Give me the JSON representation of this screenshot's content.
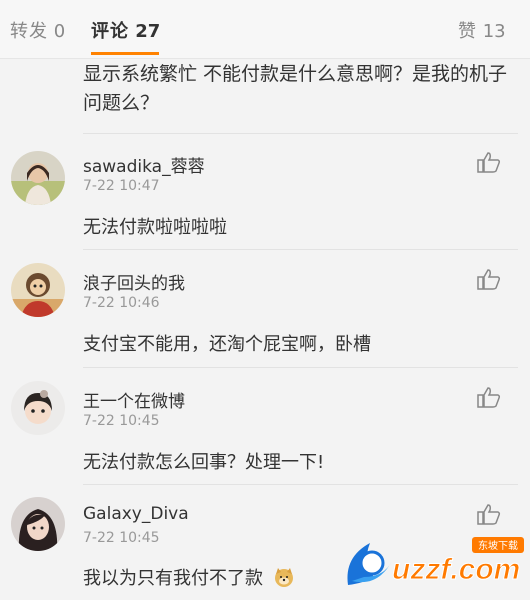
{
  "tabs": {
    "repost": {
      "label": "转发",
      "count": "0"
    },
    "comment": {
      "label": "评论",
      "count": "27"
    },
    "like": {
      "label": "赞",
      "count": "13"
    }
  },
  "truncated_comment": {
    "text": "显示系统繁忙 不能付款是什么意思啊？是我的机子问题么？"
  },
  "comments": [
    {
      "name": "sawadika_蓉蓉",
      "time": "7-22 10:47",
      "text": "无法付款啦啦啦啦"
    },
    {
      "name": "浪子回头的我",
      "time": "7-22 10:46",
      "text": "支付宝不能用，还淘个屁宝啊，卧槽"
    },
    {
      "name": "王一个在微博",
      "time": "7-22 10:45",
      "text": "无法付款怎么回事？处理一下!"
    },
    {
      "name": "Galaxy_Diva",
      "time": "7-22 10:45",
      "text": "我以为只有我付不了款"
    }
  ],
  "watermark": {
    "logo": "uzzf.com",
    "subtitle": "东坡下载"
  },
  "colors": {
    "accent": "#ff8200",
    "muted": "#999999",
    "text": "#333333"
  },
  "icons": {
    "like": "thumbs-up-icon",
    "emoji": "doge-emoji-icon"
  }
}
